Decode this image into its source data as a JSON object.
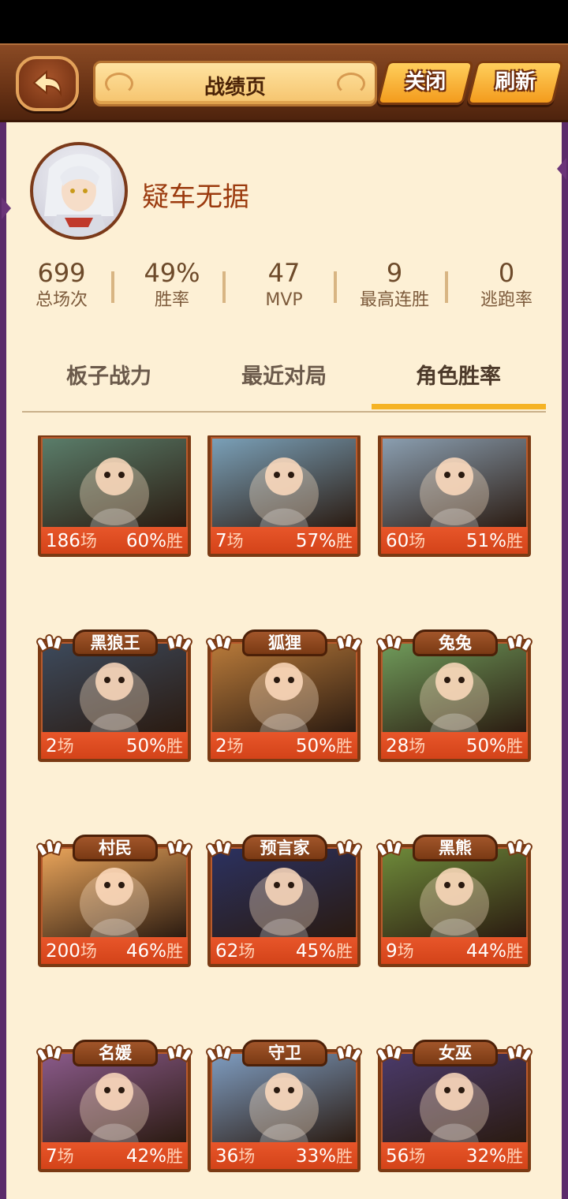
{
  "header": {
    "title": "战绩页",
    "close_label": "关闭",
    "refresh_label": "刷新"
  },
  "profile": {
    "username": "疑车无据"
  },
  "stats": [
    {
      "value": "699",
      "label": "总场次"
    },
    {
      "value": "49%",
      "label": "胜率"
    },
    {
      "value": "47",
      "label": "MVP"
    },
    {
      "value": "9",
      "label": "最高连胜"
    },
    {
      "value": "0",
      "label": "逃跑率"
    }
  ],
  "tabs": [
    {
      "label": "板子战力",
      "active": false
    },
    {
      "label": "最近对局",
      "active": false
    },
    {
      "label": "角色胜率",
      "active": true
    }
  ],
  "colors": {
    "accent": "#f5b325",
    "card_footer": "#e04b20",
    "panel_bg": "#fdf0d5",
    "title_text": "#9b3a0e"
  },
  "roles": [
    {
      "name": "",
      "games": "186",
      "games_unit": "场",
      "rate": "60%",
      "rate_unit": "胜",
      "icon": "wolf-art",
      "bg": "#5a7d6a"
    },
    {
      "name": "",
      "games": "7",
      "games_unit": "场",
      "rate": "57%",
      "rate_unit": "胜",
      "icon": "penguin-art",
      "bg": "#7aa0b8"
    },
    {
      "name": "",
      "games": "60",
      "games_unit": "场",
      "rate": "51%",
      "rate_unit": "胜",
      "icon": "hunter-art",
      "bg": "#8a9eb0"
    },
    {
      "name": "黑狼王",
      "games": "2",
      "games_unit": "场",
      "rate": "50%",
      "rate_unit": "胜",
      "icon": "black-wolf-king-art",
      "bg": "#3d4a5c"
    },
    {
      "name": "狐狸",
      "games": "2",
      "games_unit": "场",
      "rate": "50%",
      "rate_unit": "胜",
      "icon": "fox-art",
      "bg": "#b87a3a"
    },
    {
      "name": "兔兔",
      "games": "28",
      "games_unit": "场",
      "rate": "50%",
      "rate_unit": "胜",
      "icon": "rabbit-art",
      "bg": "#6f9a5a"
    },
    {
      "name": "村民",
      "games": "200",
      "games_unit": "场",
      "rate": "46%",
      "rate_unit": "胜",
      "icon": "villager-art",
      "bg": "#e9a45a"
    },
    {
      "name": "预言家",
      "games": "62",
      "games_unit": "场",
      "rate": "45%",
      "rate_unit": "胜",
      "icon": "seer-art",
      "bg": "#2b3160"
    },
    {
      "name": "黑熊",
      "games": "9",
      "games_unit": "场",
      "rate": "44%",
      "rate_unit": "胜",
      "icon": "black-bear-art",
      "bg": "#6e8a3a"
    },
    {
      "name": "名媛",
      "games": "7",
      "games_unit": "场",
      "rate": "42%",
      "rate_unit": "胜",
      "icon": "socialite-art",
      "bg": "#8a5a8a"
    },
    {
      "name": "守卫",
      "games": "36",
      "games_unit": "场",
      "rate": "33%",
      "rate_unit": "胜",
      "icon": "guard-art",
      "bg": "#7e9cc0"
    },
    {
      "name": "女巫",
      "games": "56",
      "games_unit": "场",
      "rate": "32%",
      "rate_unit": "胜",
      "icon": "witch-art",
      "bg": "#4a3a6a"
    }
  ]
}
